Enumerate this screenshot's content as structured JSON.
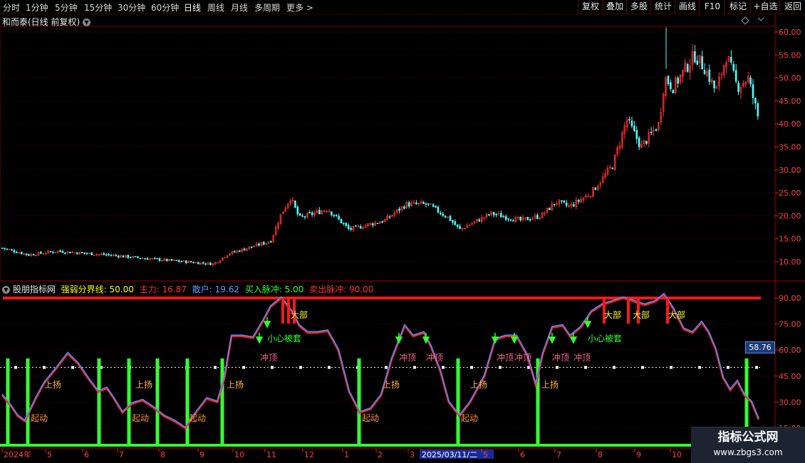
{
  "toolbar": {
    "periods": [
      "分时",
      "1分钟",
      "5分钟",
      "15分钟",
      "30分钟",
      "60分钟",
      "日线",
      "周线",
      "月线",
      "多周期",
      "更多 >"
    ],
    "active_period": "日线",
    "right_buttons": [
      "复权",
      "叠加",
      "多股",
      "统计",
      "画线",
      "F10",
      "标记",
      "+自选",
      "返回"
    ]
  },
  "main_panel": {
    "title": "和而泰(日线 前复权)",
    "price_axis": [
      "60.00",
      "55.00",
      "50.00",
      "45.00",
      "40.00",
      "35.00",
      "30.00",
      "25.00",
      "20.00",
      "15.00",
      "10.00"
    ],
    "colors": {
      "up": "#ff3232",
      "down": "#54fcfc",
      "axis": "#ff4040",
      "grid": "#6a0000"
    }
  },
  "indicator_panel": {
    "name": "股朋指标网",
    "params": [
      {
        "label": "强弱分界线: 50.00",
        "color": "#ffff00"
      },
      {
        "label": "主力: 16.87",
        "color": "#ff3030"
      },
      {
        "label": "散户: 19.62",
        "color": "#5aa0ff"
      },
      {
        "label": "买入脉冲: 5.00",
        "color": "#30ff30"
      },
      {
        "label": "卖出脉冲: 90.00",
        "color": "#ff3030"
      }
    ],
    "axis": [
      "90.00",
      "75.00",
      "60.00",
      "45.00",
      "30.00",
      "15.00"
    ],
    "current_value": "58.76",
    "labels": {
      "startup": "起动",
      "rise": "上扬",
      "rush": "冲顶",
      "careful": "小心被套",
      "top": "大部"
    }
  },
  "date_axis": [
    "2024年",
    "5",
    "6",
    "7",
    "8",
    "9",
    "10",
    "11",
    "12",
    "1",
    "2",
    "3",
    "2025/03/11/二",
    "5",
    "6",
    "7",
    "8",
    "9",
    "10"
  ],
  "watermark": {
    "title": "指标公式网",
    "url": "www.zbgs3.com"
  }
}
